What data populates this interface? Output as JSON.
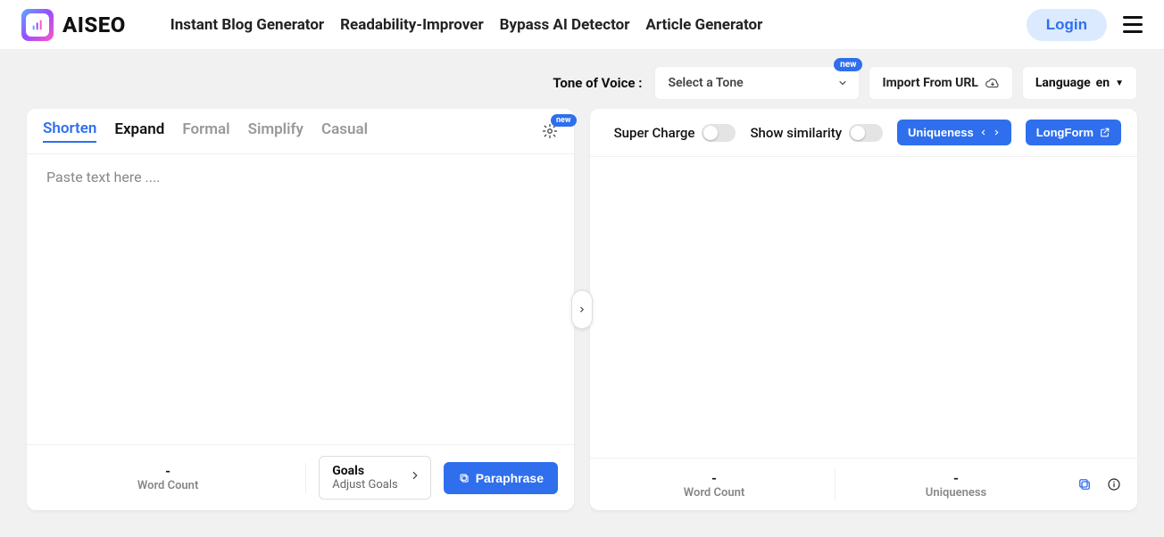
{
  "brand": "AISEO",
  "nav": {
    "blog": "Instant Blog Generator",
    "read": "Readability-Improver",
    "bypass": "Bypass AI Detector",
    "article": "Article Generator"
  },
  "login": "Login",
  "controls": {
    "tov_label": "Tone of Voice :",
    "tov_value": "Select a Tone",
    "tov_badge": "new",
    "import_url": "Import From URL",
    "language_label": "Language",
    "language_value": "en"
  },
  "tabs": {
    "shorten": "Shorten",
    "expand": "Expand",
    "formal": "Formal",
    "simplify": "Simplify",
    "casual": "Casual",
    "gear_badge": "new"
  },
  "editor": {
    "placeholder": "Paste text here ...."
  },
  "left_foot": {
    "wc_value": "-",
    "wc_label": "Word Count",
    "goals_title": "Goals",
    "goals_sub": "Adjust Goals",
    "paraphrase": "Paraphrase"
  },
  "right_head": {
    "super": "Super Charge",
    "sim": "Show similarity",
    "uniq": "Uniqueness",
    "longform": "LongForm"
  },
  "right_foot": {
    "wc_value": "-",
    "wc_label": "Word Count",
    "uniq_value": "-",
    "uniq_label": "Uniqueness"
  }
}
